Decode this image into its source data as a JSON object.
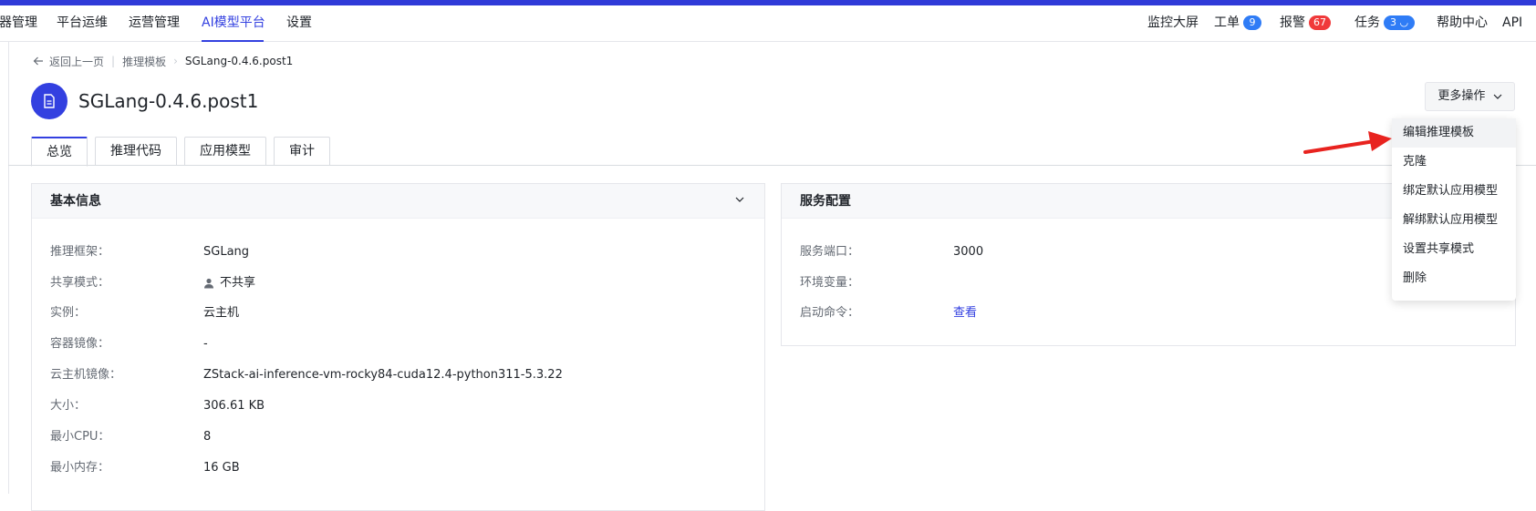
{
  "nav": {
    "items": [
      {
        "label": "器管理"
      },
      {
        "label": "平台运维"
      },
      {
        "label": "运营管理"
      },
      {
        "label": "AI模型平台"
      },
      {
        "label": "设置"
      }
    ],
    "right": {
      "monitor": "监控大屏",
      "ticket_label": "工单",
      "ticket_count": "9",
      "alarm_label": "报警",
      "alarm_count": "67",
      "task_label": "任务",
      "task_count": "3",
      "help": "帮助中心",
      "api": "API"
    }
  },
  "breadcrumb": {
    "back": "返回上一页",
    "parent": "推理模板",
    "current": "SGLang-0.4.6.post1"
  },
  "page": {
    "title": "SGLang-0.4.6.post1",
    "more_button": "更多操作"
  },
  "tabs": [
    {
      "label": "总览"
    },
    {
      "label": "推理代码"
    },
    {
      "label": "应用模型"
    },
    {
      "label": "审计"
    }
  ],
  "basic_info": {
    "title": "基本信息",
    "rows": [
      {
        "label": "推理框架：",
        "value": "SGLang"
      },
      {
        "label": "共享模式：",
        "value": "不共享"
      },
      {
        "label": "实例：",
        "value": "云主机"
      },
      {
        "label": "容器镜像：",
        "value": "-"
      },
      {
        "label": "云主机镜像：",
        "value": "ZStack-ai-inference-vm-rocky84-cuda12.4-python311-5.3.22"
      },
      {
        "label": "大小：",
        "value": "306.61 KB"
      },
      {
        "label": "最小CPU：",
        "value": "8"
      },
      {
        "label": "最小内存：",
        "value": "16 GB"
      }
    ]
  },
  "service_config": {
    "title": "服务配置",
    "rows": [
      {
        "label": "服务端口：",
        "value": "3000"
      },
      {
        "label": "环境变量：",
        "value": ""
      },
      {
        "label": "启动命令：",
        "value": "查看"
      }
    ]
  },
  "dropdown": {
    "items": [
      {
        "label": "编辑推理模板"
      },
      {
        "label": "克隆"
      },
      {
        "label": "绑定默认应用模型"
      },
      {
        "label": "解绑默认应用模型"
      },
      {
        "label": "设置共享模式"
      },
      {
        "label": "删除"
      }
    ]
  },
  "colors": {
    "accent": "#3340e0",
    "badge_blue": "#2f7cf6",
    "badge_red": "#f0393a",
    "annotation_arrow": "#e8231f"
  }
}
